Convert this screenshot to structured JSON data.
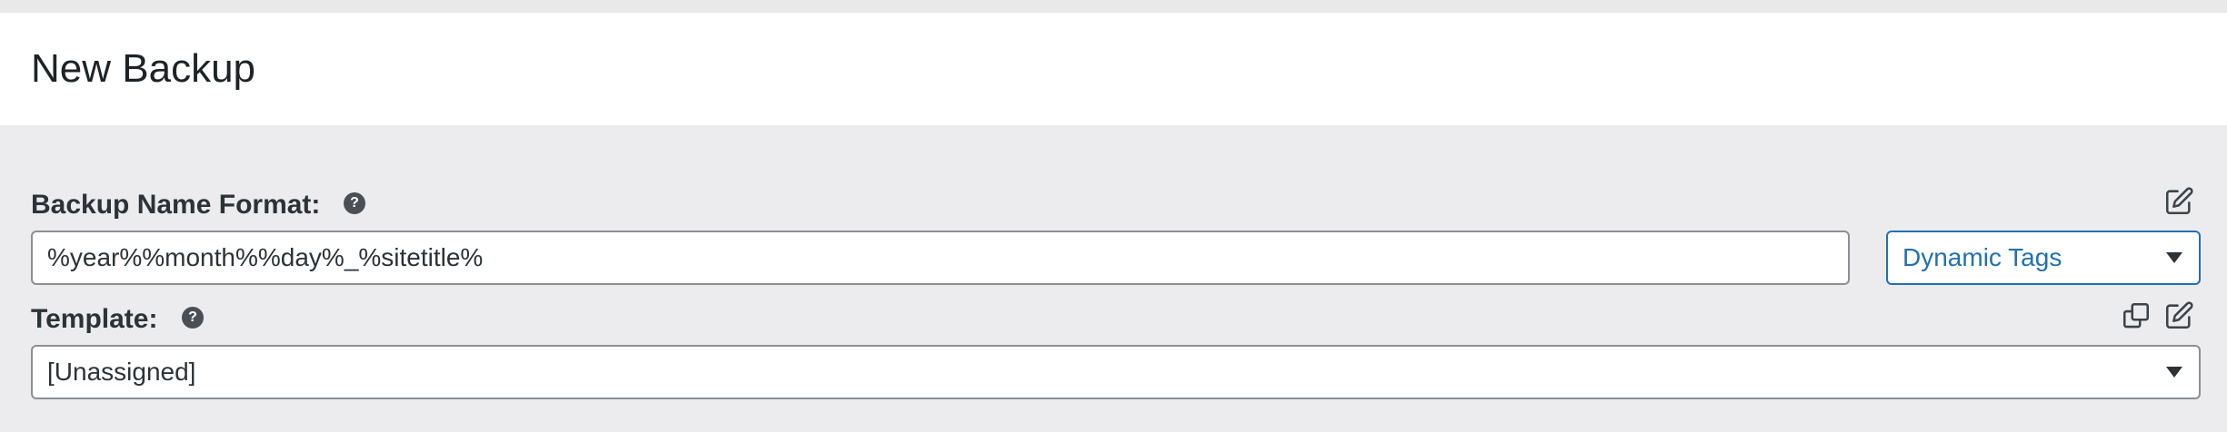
{
  "page": {
    "title": "New Backup"
  },
  "backup_name": {
    "label": "Backup Name Format:",
    "help_icon": "question-circle-icon",
    "value": "%year%%month%%day%_%sitetitle%",
    "dynamic_tags": {
      "selected": "Dynamic Tags"
    },
    "edit_icon": "edit-icon"
  },
  "template": {
    "label": "Template:",
    "help_icon": "question-circle-icon",
    "selected": "[Unassigned]",
    "copy_icon": "copy-icon",
    "edit_icon": "edit-icon"
  },
  "colors": {
    "accent": "#2271b1",
    "background": "#ececee",
    "header_bg": "#ffffff"
  }
}
